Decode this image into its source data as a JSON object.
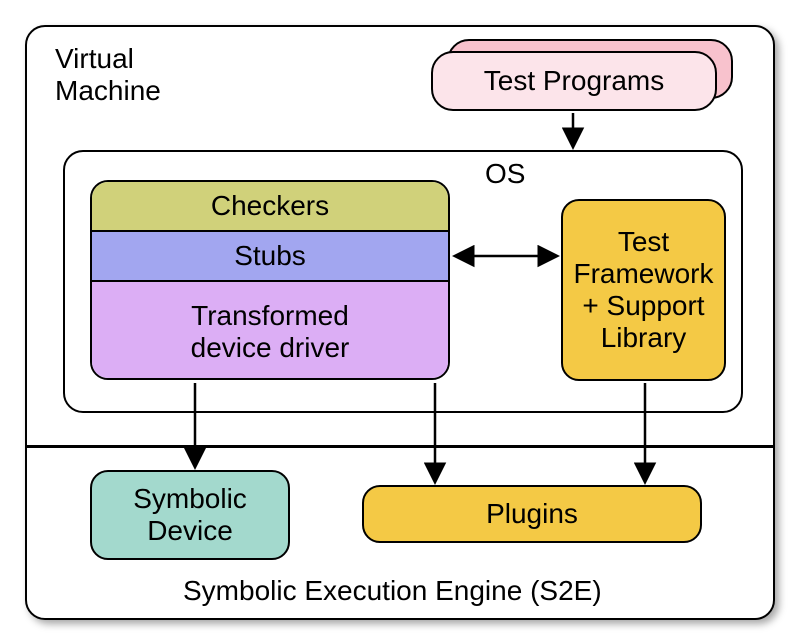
{
  "labels": {
    "vm": "Virtual\nMachine",
    "test_programs": "Test Programs",
    "os": "OS",
    "checkers": "Checkers",
    "stubs": "Stubs",
    "driver": "Transformed\ndevice driver",
    "test_framework": "Test\nFramework\n+ Support\nLibrary",
    "symbolic_device": "Symbolic\nDevice",
    "plugins": "Plugins",
    "engine": "Symbolic Execution Engine (S2E)"
  }
}
